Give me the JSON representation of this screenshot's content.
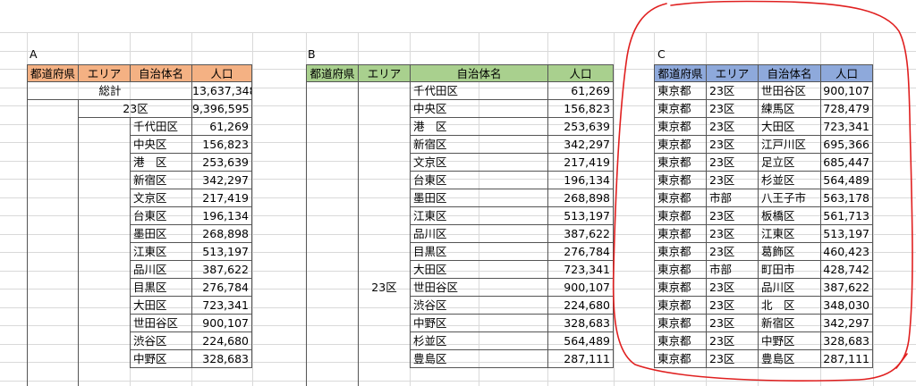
{
  "colors": {
    "orange": "#f4b183",
    "green": "#a9d08e",
    "blue": "#8ea9db",
    "red_annotation": "#e02020"
  },
  "sheet": {
    "a": {
      "label": "A",
      "headers": [
        "都道府県",
        "エリア",
        "自治体名",
        "人口"
      ],
      "total_label": "総計",
      "total_value": "13,637,348",
      "sub_label": "23区",
      "sub_value": "9,396,595",
      "rows": [
        [
          "千代田区",
          "61,269"
        ],
        [
          "中央区",
          "156,823"
        ],
        [
          "港　区",
          "253,639"
        ],
        [
          "新宿区",
          "342,297"
        ],
        [
          "文京区",
          "217,419"
        ],
        [
          "台東区",
          "196,134"
        ],
        [
          "墨田区",
          "268,898"
        ],
        [
          "江東区",
          "513,197"
        ],
        [
          "品川区",
          "387,622"
        ],
        [
          "目黒区",
          "276,784"
        ],
        [
          "大田区",
          "723,341"
        ],
        [
          "世田谷区",
          "900,107"
        ],
        [
          "渋谷区",
          "224,680"
        ],
        [
          "中野区",
          "328,683"
        ]
      ]
    },
    "b": {
      "label": "B",
      "headers": [
        "都道府県",
        "エリア",
        "自治体名",
        "人口"
      ],
      "area_label": "23区",
      "rows": [
        [
          "千代田区",
          "61,269"
        ],
        [
          "中央区",
          "156,823"
        ],
        [
          "港　区",
          "253,639"
        ],
        [
          "新宿区",
          "342,297"
        ],
        [
          "文京区",
          "217,419"
        ],
        [
          "台東区",
          "196,134"
        ],
        [
          "墨田区",
          "268,898"
        ],
        [
          "江東区",
          "513,197"
        ],
        [
          "品川区",
          "387,622"
        ],
        [
          "目黒区",
          "276,784"
        ],
        [
          "大田区",
          "723,341"
        ],
        [
          "世田谷区",
          "900,107"
        ],
        [
          "渋谷区",
          "224,680"
        ],
        [
          "中野区",
          "328,683"
        ],
        [
          "杉並区",
          "564,489"
        ],
        [
          "豊島区",
          "287,111"
        ]
      ]
    },
    "c": {
      "label": "C",
      "headers": [
        "都道府県",
        "エリア",
        "自治体名",
        "人口"
      ],
      "rows": [
        [
          "東京都",
          "23区",
          "世田谷区",
          "900,107"
        ],
        [
          "東京都",
          "23区",
          "練馬区",
          "728,479"
        ],
        [
          "東京都",
          "23区",
          "大田区",
          "723,341"
        ],
        [
          "東京都",
          "23区",
          "江戸川区",
          "695,366"
        ],
        [
          "東京都",
          "23区",
          "足立区",
          "685,447"
        ],
        [
          "東京都",
          "23区",
          "杉並区",
          "564,489"
        ],
        [
          "東京都",
          "市部",
          "八王子市",
          "563,178"
        ],
        [
          "東京都",
          "23区",
          "板橋区",
          "561,713"
        ],
        [
          "東京都",
          "23区",
          "江東区",
          "513,197"
        ],
        [
          "東京都",
          "23区",
          "葛飾区",
          "460,423"
        ],
        [
          "東京都",
          "市部",
          "町田市",
          "428,742"
        ],
        [
          "東京都",
          "23区",
          "品川区",
          "387,622"
        ],
        [
          "東京都",
          "23区",
          "北　区",
          "348,030"
        ],
        [
          "東京都",
          "23区",
          "新宿区",
          "342,297"
        ],
        [
          "東京都",
          "23区",
          "中野区",
          "328,683"
        ],
        [
          "東京都",
          "23区",
          "豊島区",
          "287,111"
        ]
      ]
    }
  }
}
